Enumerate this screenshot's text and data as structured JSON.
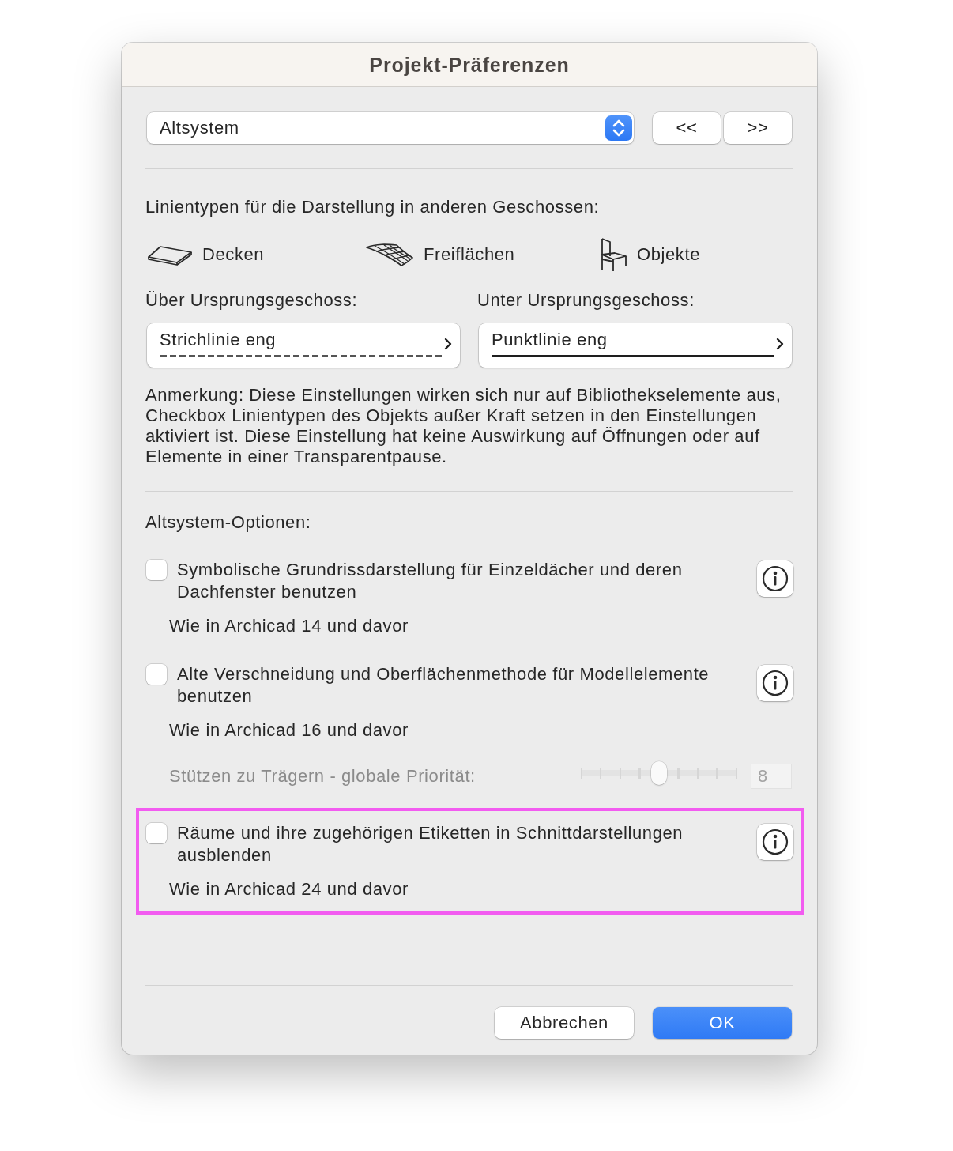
{
  "window": {
    "title": "Projekt-Präferenzen"
  },
  "preset_select": {
    "value": "Altsystem"
  },
  "nav_buttons": [
    "<<",
    ">>"
  ],
  "line_types": {
    "heading": "Linientypen für die Darstellung in anderen Geschossen:",
    "categories": [
      {
        "kind": "slab",
        "label": "Decken"
      },
      {
        "kind": "mesh",
        "label": "Freiflächen"
      },
      {
        "kind": "object",
        "label": "Objekte"
      }
    ],
    "pickers": [
      {
        "label": "Über Ursprungsgeschoss:",
        "value": "Strichlinie eng",
        "dashed": true
      },
      {
        "label": "Unter Ursprungsgeschoss:",
        "value": "Punktlinie eng",
        "dashed": false
      }
    ]
  },
  "note": "Anmerkung: Diese Einstellungen wirken sich nur auf Bibliothekselemente aus, Checkbox Linientypen des Objekts außer Kraft setzen in den Einstellungen aktiviert ist. Diese Einstellung hat keine Auswirkung auf Öffnungen oder auf Elemente in einer Transparentpause.",
  "legacy_options": {
    "heading": "Altsystem-Optionen:",
    "items": [
      {
        "kind": "checkbox",
        "label": "Symbolische Grundrissdarstellung für Einzeldächer und deren Dachfenster benutzen",
        "checked": false,
        "highlighted": false,
        "caption": "Wie in Archicad 14 und davor"
      },
      {
        "kind": "checkbox",
        "label": "Alte Verschneidung und Oberflächenmethode für Modellelemente benutzen",
        "checked": false,
        "highlighted": false,
        "caption": "Wie in Archicad 16 und davor"
      },
      {
        "kind": "slider",
        "label": "Stützen zu Trägern - globale Priorität:",
        "disabled": true,
        "level": 0.5,
        "value": "8"
      },
      {
        "kind": "checkbox",
        "label": "Räume und ihre zugehörigen Etiketten in Schnittdarstellungen ausblenden",
        "checked": false,
        "highlighted": true,
        "caption": "Wie in Archicad 24 und davor"
      }
    ]
  },
  "buttons": [
    {
      "kind": "cancel",
      "label": "Abbrechen"
    },
    {
      "kind": "confirm",
      "label": "OK"
    }
  ]
}
